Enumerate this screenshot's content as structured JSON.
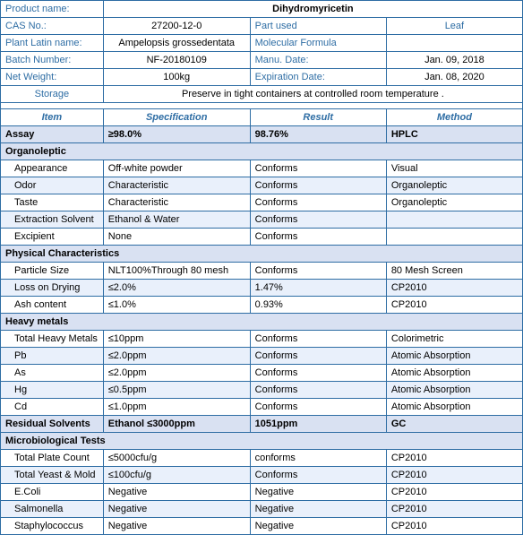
{
  "header": {
    "product_label": "Product name:",
    "product_name": "Dihydromyricetin",
    "cas_label": "CAS No.:",
    "cas_value": "27200-12-0",
    "part_used_label": "Part used",
    "part_used_value": "Leaf",
    "plant_label": "Plant Latin name:",
    "plant_value": "Ampelopsis grossedentata",
    "mol_label": "Molecular Formula",
    "batch_label": "Batch Number:",
    "batch_value": "NF-20180109",
    "manu_label": "Manu. Date:",
    "manu_value": "Jan. 09, 2018",
    "net_label": "Net Weight:",
    "net_value": "100kg",
    "exp_label": "Expiration Date:",
    "exp_value": "Jan. 08, 2020",
    "storage_label": "Storage",
    "storage_value": "Preserve in tight containers at controlled room temperature ."
  },
  "table_headers": {
    "item": "Item",
    "specification": "Specification",
    "result": "Result",
    "method": "Method"
  },
  "sections": [
    {
      "type": "section",
      "label": "Assay",
      "rows": [
        {
          "item": "Assay",
          "spec": "≥98.0%",
          "result": "98.76%",
          "method": "HPLC",
          "bold": true,
          "indent": false
        }
      ]
    },
    {
      "type": "section",
      "label": "Organoleptic",
      "rows": [
        {
          "item": "Appearance",
          "spec": "Off-white powder",
          "result": "Conforms",
          "method": "Visual",
          "alt": false
        },
        {
          "item": "Odor",
          "spec": "Characteristic",
          "result": "Conforms",
          "method": "Organoleptic",
          "alt": true
        },
        {
          "item": "Taste",
          "spec": "Characteristic",
          "result": "Conforms",
          "method": "Organoleptic",
          "alt": false
        },
        {
          "item": "Extraction Solvent",
          "spec": "Ethanol & Water",
          "result": "Conforms",
          "method": "",
          "alt": true
        },
        {
          "item": "Excipient",
          "spec": "None",
          "result": "Conforms",
          "method": "",
          "alt": false
        }
      ]
    },
    {
      "type": "section",
      "label": "Physical Characteristics",
      "rows": [
        {
          "item": "Particle Size",
          "spec": "NLT100%Through 80 mesh",
          "result": "Conforms",
          "method": "80 Mesh Screen",
          "alt": false
        },
        {
          "item": "Loss on Drying",
          "spec": "≤2.0%",
          "result": "1.47%",
          "method": "CP2010",
          "alt": true
        },
        {
          "item": "Ash content",
          "spec": "≤1.0%",
          "result": "0.93%",
          "method": "CP2010",
          "alt": false
        }
      ]
    },
    {
      "type": "section",
      "label": "Heavy metals",
      "rows": [
        {
          "item": "Total Heavy Metals",
          "spec": "≤10ppm",
          "result": "Conforms",
          "method": "Colorimetric",
          "alt": false
        },
        {
          "item": "Pb",
          "spec": "≤2.0ppm",
          "result": "Conforms",
          "method": "Atomic Absorption",
          "alt": true
        },
        {
          "item": "As",
          "spec": "≤2.0ppm",
          "result": "Conforms",
          "method": "Atomic Absorption",
          "alt": false
        },
        {
          "item": "Hg",
          "spec": "≤0.5ppm",
          "result": "Conforms",
          "method": "Atomic Absorption",
          "alt": true
        },
        {
          "item": "Cd",
          "spec": "≤1.0ppm",
          "result": "Conforms",
          "method": "Atomic Absorption",
          "alt": false
        }
      ]
    },
    {
      "type": "section",
      "label": "Residual Solvents",
      "rows": [
        {
          "item": "Residual Solvents",
          "spec": "Ethanol ≤3000ppm",
          "result": "1051ppm",
          "method": "GC",
          "bold": true,
          "indent": false
        }
      ]
    },
    {
      "type": "section",
      "label": "Microbiological Tests",
      "rows": [
        {
          "item": "Total Plate Count",
          "spec": "≤5000cfu/g",
          "result": "conforms",
          "method": "CP2010",
          "alt": false
        },
        {
          "item": "Total Yeast & Mold",
          "spec": "≤100cfu/g",
          "result": "Conforms",
          "method": "CP2010",
          "alt": true
        },
        {
          "item": "E.Coli",
          "spec": "Negative",
          "result": "Negative",
          "method": "CP2010",
          "alt": false
        },
        {
          "item": "Salmonella",
          "spec": "Negative",
          "result": "Negative",
          "method": "CP2010",
          "alt": true
        },
        {
          "item": "Staphylococcus",
          "spec": "Negative",
          "result": "Negative",
          "method": "CP2010",
          "alt": false
        }
      ]
    }
  ]
}
